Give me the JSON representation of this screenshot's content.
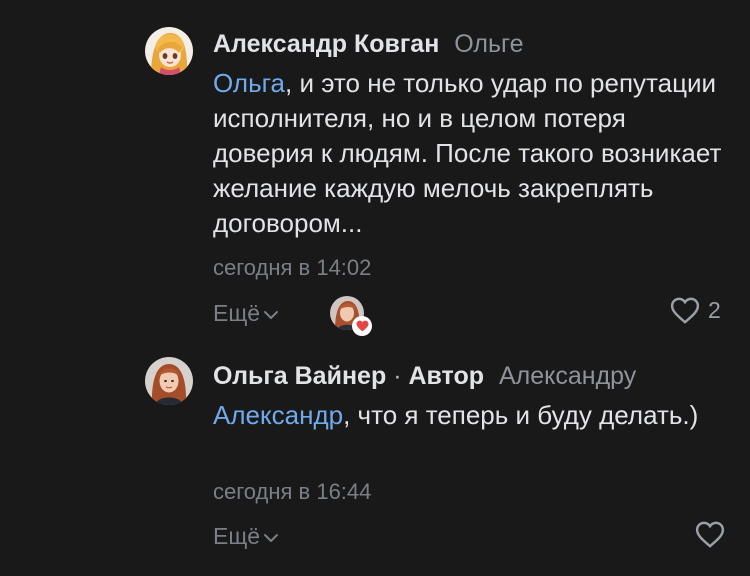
{
  "comments": [
    {
      "author": "Александр Ковган",
      "reply_to": "Ольге",
      "mention": "Ольга",
      "text": ", и это не только удар по репутации исполнителя, но и в целом потеря доверия к людям. После такого возникает желание каждую мелочь закреплять договором...",
      "date": "сегодня в 14:02",
      "more_label": "Ещё",
      "likes": "2",
      "avatar_icon": "anime-girl-avatar",
      "reaction_icon": "heart-icon"
    },
    {
      "author": "Ольга Вайнер",
      "separator": "·",
      "role": "Автор",
      "reply_to": "Александру",
      "mention": "Александр",
      "text": ", что я теперь и буду делать.)",
      "date": "сегодня в 16:44",
      "more_label": "Ещё",
      "avatar_icon": "user-photo-avatar"
    }
  ],
  "colors": {
    "background": "#19191a",
    "text": "#e1e3e6",
    "mention": "#71aaeb",
    "secondary": "#7a7f86",
    "reaction_heart": "#e64646"
  }
}
